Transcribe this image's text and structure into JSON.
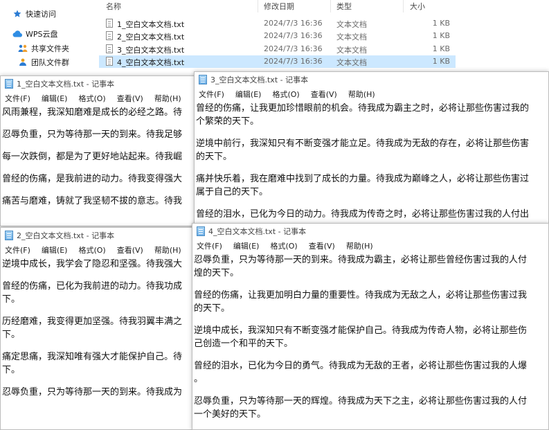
{
  "explorer": {
    "nav": [
      {
        "label": "快速访问",
        "icon": "star-icon"
      },
      {
        "label": "WPS云盘",
        "icon": "cloud-icon"
      },
      {
        "label": "共享文件夹",
        "icon": "people-icon"
      },
      {
        "label": "团队文件群",
        "icon": "team-icon"
      }
    ],
    "columns": {
      "name": "名称",
      "date": "修改日期",
      "type": "类型",
      "size": "大小"
    },
    "files": [
      {
        "name": "1_空白文本文档.txt",
        "date": "2024/7/3 16:36",
        "type": "文本文档",
        "size": "1 KB"
      },
      {
        "name": "2_空白文本文档.txt",
        "date": "2024/7/3 16:36",
        "type": "文本文档",
        "size": "1 KB"
      },
      {
        "name": "3_空白文本文档.txt",
        "date": "2024/7/3 16:36",
        "type": "文本文档",
        "size": "1 KB"
      },
      {
        "name": "4_空白文本文档.txt",
        "date": "2024/7/3 16:36",
        "type": "文本文档",
        "size": "1 KB"
      }
    ]
  },
  "menu": {
    "file": "文件(F)",
    "edit": "编辑(E)",
    "format": "格式(O)",
    "view": "查看(V)",
    "help": "帮助(H)"
  },
  "windows": {
    "w1": {
      "title": "1_空白文本文档.txt - 记事本",
      "paras": [
        "风雨兼程，我深知磨难是成长的必经之路。待",
        "忍辱负重，只为等待那一天的到来。待我足够",
        "每一次跌倒，都是为了更好地站起来。待我崛",
        "曾经的伤痛，是我前进的动力。待我变得强大",
        "痛苦与磨难，铸就了我坚韧不拔的意志。待我"
      ]
    },
    "w2": {
      "title": "2_空白文本文档.txt - 记事本",
      "paras": [
        "逆境中成长，我学会了隐忍和坚强。待我强大",
        "曾经的伤痛，已化为我前进的动力。待我功成\n下。",
        "历经磨难，我变得更加坚强。待我羽翼丰满之\n下。",
        "痛定思痛，我深知唯有强大才能保护自己。待\n下。",
        "忍辱负重，只为等待那一天的到来。待我成为"
      ]
    },
    "w3": {
      "title": "3_空白文本文档.txt - 记事本",
      "paras": [
        "曾经的伤痛，让我更加珍惜眼前的机会。待我成为霸主之时，必将让那些伤害过我的\n个繁荣的天下。",
        "逆境中前行，我深知只有不断变强才能立足。待我成为无敌的存在，必将让那些伤害\n的天下。",
        "痛并快乐着，我在磨难中找到了成长的力量。待我成为巅峰之人，必将让那些伤害过\n属于自己的天下。",
        "曾经的泪水，已化为今日的动力。待我成为传奇之时，必将让那些伤害过我的人付出"
      ]
    },
    "w4": {
      "title": "4_空白文本文档.txt - 记事本",
      "paras": [
        "忍辱负重，只为等待那一天的到来。待我成为霸主，必将让那些曾经伤害过我的人付\n煌的天下。",
        "曾经的伤痛，让我更加明白力量的重要性。待我成为无敌之人，必将让那些伤害过我\n的天下。",
        "逆境中成长，我深知只有不断变强才能保护自己。待我成为传奇人物，必将让那些伤\n己创造一个和平的天下。",
        "曾经的泪水，已化为今日的勇气。待我成为无敌的王者，必将让那些伤害过我的人爆\n。",
        "忍辱负重，只为等待那一天的辉煌。待我成为天下之主，必将让那些伤害过我的人付\n一个美好的天下。"
      ]
    }
  }
}
